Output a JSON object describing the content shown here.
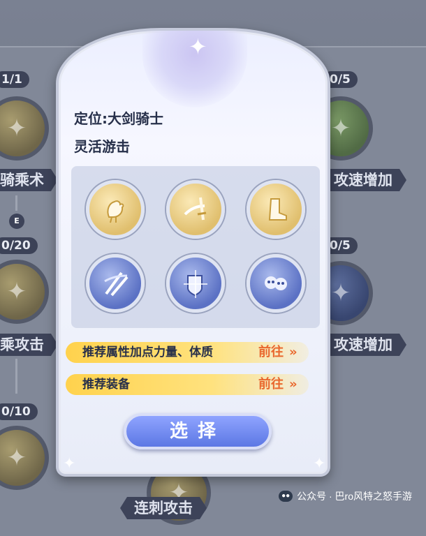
{
  "background_tree": {
    "counters": [
      "1/1",
      "0/20",
      "0/10",
      "0/5",
      "0/5"
    ],
    "tags": [
      "骑乘术",
      "乘攻击",
      "攻速增加",
      "攻速增加",
      "连刺攻击"
    ],
    "marker": "E"
  },
  "modal": {
    "role": "定位:大剑骑士",
    "playstyle": "灵活游击",
    "skills": [
      {
        "icon": "chocobo-mount-icon",
        "color": "gold"
      },
      {
        "icon": "sword-slash-icon",
        "color": "gold"
      },
      {
        "icon": "boot-icon",
        "color": "gold"
      },
      {
        "icon": "twin-swords-icon",
        "color": "blue"
      },
      {
        "icon": "shield-burst-icon",
        "color": "blue"
      },
      {
        "icon": "skull-crowd-icon",
        "color": "blue"
      }
    ],
    "recommend_attr": "推荐属性加点力量、体质",
    "recommend_gear": "推荐装备",
    "goto_label": "前往",
    "goto_chevron": "»",
    "choose_button": "选择"
  },
  "watermark": {
    "text": "公众号 · 巴ro风特之怒手游"
  },
  "colors": {
    "accent_orange": "#e9682e",
    "banner_yellow": "#ffd24d",
    "button_blue": "#5c77e4"
  }
}
